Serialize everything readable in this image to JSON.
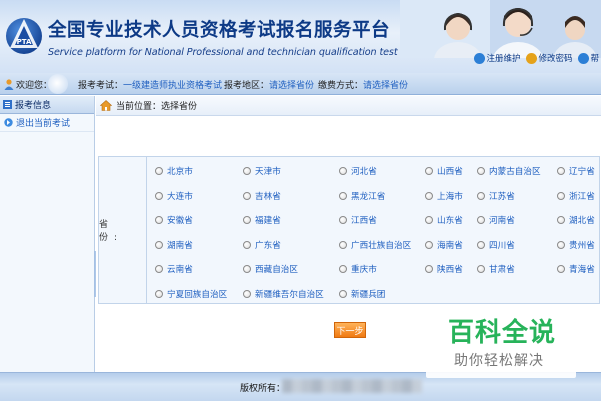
{
  "header": {
    "title_cn": "全国专业技术人员资格考试报名服务平台",
    "title_en": "Service platform for National Professional and technician qualification test",
    "logo_text": "PTA",
    "links": [
      {
        "label": "注册维护",
        "icon": "register-icon",
        "color": "#2c7fd6"
      },
      {
        "label": "修改密码",
        "icon": "lock-icon",
        "color": "#e5a21a"
      },
      {
        "label": "帮",
        "icon": "help-icon",
        "color": "#2c7fd6"
      }
    ]
  },
  "infobar": {
    "welcome_label": "欢迎您：",
    "exam_label": "报考考试：",
    "exam_value": "一级建造师执业资格考试",
    "region_label": "报考地区：",
    "region_value": "请选择省份",
    "payment_label": "缴费方式：",
    "payment_value": "请选择省份"
  },
  "sidebar": {
    "header": "报考信息",
    "items": [
      {
        "label": "退出当前考试"
      }
    ]
  },
  "main": {
    "location": "当前位置：选择省份",
    "province_label": "省  份:",
    "provinces": [
      [
        "北京市",
        "天津市",
        "河北省",
        "山西省",
        "内蒙古自治区",
        "辽宁省"
      ],
      [
        "大连市",
        "吉林省",
        "黑龙江省",
        "上海市",
        "江苏省",
        "浙江省"
      ],
      [
        "安徽省",
        "福建省",
        "江西省",
        "山东省",
        "河南省",
        "湖北省"
      ],
      [
        "湖南省",
        "广东省",
        "广西壮族自治区",
        "海南省",
        "四川省",
        "贵州省"
      ],
      [
        "云南省",
        "西藏自治区",
        "重庆市",
        "陕西省",
        "甘肃省",
        "青海省"
      ],
      [
        "宁夏回族自治区",
        "新疆维吾尔自治区",
        "新疆兵团"
      ]
    ],
    "next_button": "下一步"
  },
  "footer": {
    "copyright": "版权所有："
  },
  "watermark": {
    "line1": "百科全说",
    "line2": "助你轻松解决"
  },
  "colors": {
    "link": "#1f5fc0",
    "title": "#0d3a86",
    "button": "#f07a12",
    "watermark": "#27b35a"
  }
}
